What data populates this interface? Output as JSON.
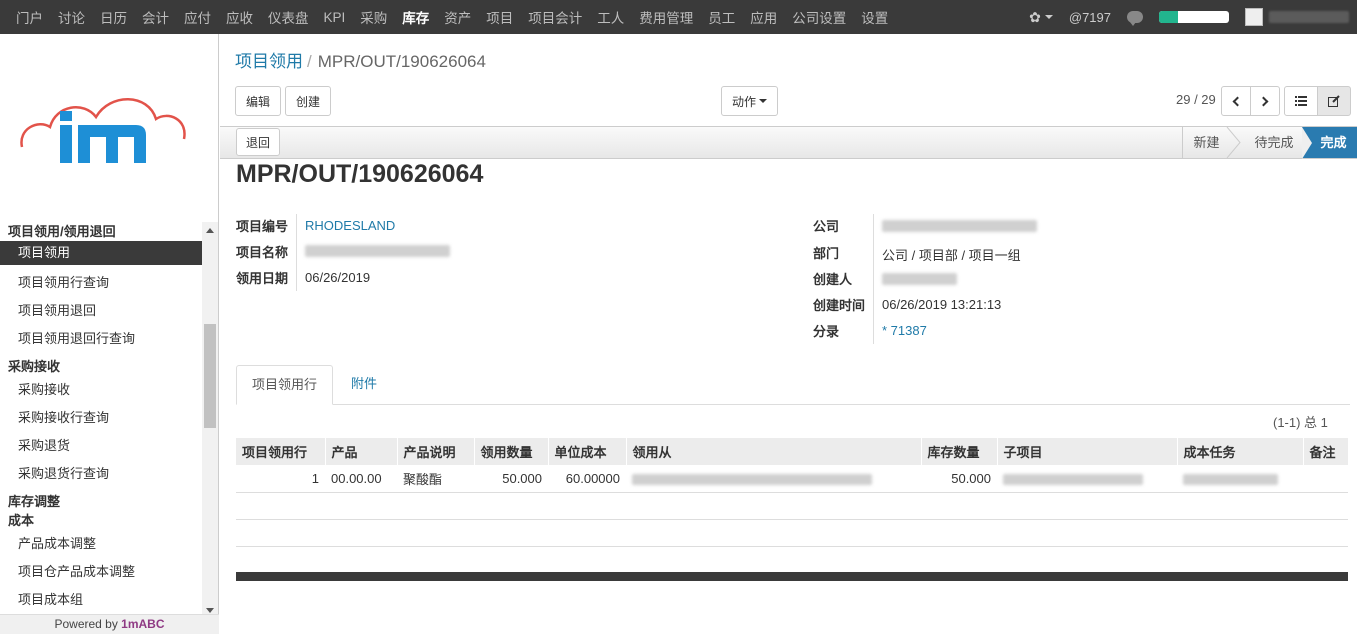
{
  "topmenu": [
    "门户",
    "讨论",
    "日历",
    "会计",
    "应付",
    "应收",
    "仪表盘",
    "KPI",
    "采购",
    "库存",
    "资产",
    "项目",
    "项目会计",
    "工人",
    "费用管理",
    "员工",
    "应用",
    "公司设置",
    "设置"
  ],
  "topmenu_active": "库存",
  "topright": {
    "mentions": "@7197",
    "progress": 0.27
  },
  "sidebar": {
    "powered_prefix": "Powered by ",
    "powered_brand": "1mABC",
    "sections": [
      {
        "title": "项目领用/领用退回",
        "items": [
          "项目领用",
          "项目领用行查询",
          "项目领用退回",
          "项目领用退回行查询"
        ]
      },
      {
        "title": "采购接收",
        "items": [
          "采购接收",
          "采购接收行查询",
          "采购退货",
          "采购退货行查询"
        ]
      },
      {
        "title": "库存调整",
        "items": []
      },
      {
        "title": "成本",
        "items": [
          "产品成本调整",
          "项目仓产品成本调整",
          "项目成本组"
        ]
      }
    ],
    "active_item": "项目领用"
  },
  "breadcrumb": {
    "parent": "项目领用",
    "current": "MPR/OUT/190626064"
  },
  "toolbar": {
    "edit": "编辑",
    "create": "创建",
    "actions": "动作",
    "pager": "29 / 29"
  },
  "status": {
    "return_button": "退回",
    "steps": [
      "新建",
      "待完成",
      "完成"
    ],
    "active": "完成"
  },
  "record": {
    "title": "MPR/OUT/190626064",
    "left": [
      {
        "label": "项目编号",
        "value": "RHODESLAND",
        "link": true
      },
      {
        "label": "项目名称",
        "value": ""
      },
      {
        "label": "领用日期",
        "value": "06/26/2019"
      }
    ],
    "right": [
      {
        "label": "公司",
        "value": ""
      },
      {
        "label": "部门",
        "value": "公司 / 项目部 / 项目一组"
      },
      {
        "label": "创建人",
        "value": ""
      },
      {
        "label": "创建时间",
        "value": "06/26/2019 13:21:13"
      },
      {
        "label": "分录",
        "value": "* 71387",
        "link": true
      }
    ]
  },
  "tabs": [
    "项目领用行",
    "附件"
  ],
  "table": {
    "count": "(1-1) 总 1",
    "headers": [
      "项目领用行",
      "产品",
      "产品说明",
      "领用数量",
      "单位成本",
      "领用从",
      "库存数量",
      "子项目",
      "成本任务",
      "备注"
    ],
    "rows": [
      {
        "line": "1",
        "product": "00.00.00",
        "desc": "聚酸酯",
        "qty": "50.000",
        "unit_cost": "60.00000",
        "from": "",
        "stock_qty": "50.000",
        "subproject": "",
        "cost_task": "",
        "note": ""
      }
    ]
  }
}
